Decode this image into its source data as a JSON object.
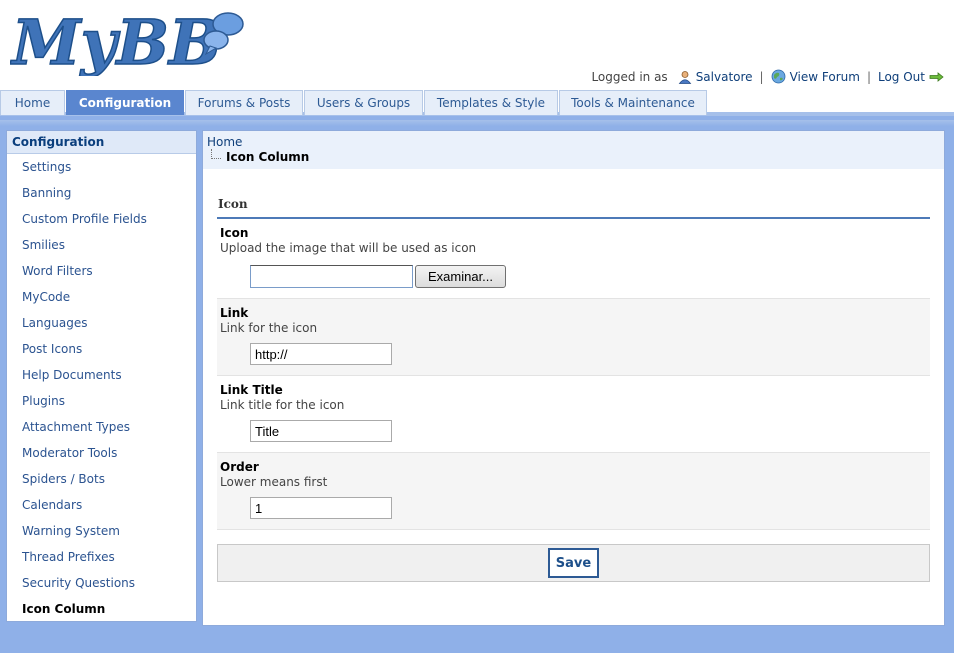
{
  "logo": {
    "text": "MyBB"
  },
  "userbar": {
    "logged_in_label": "Logged in as",
    "username": "Salvatore",
    "view_forum": "View Forum",
    "logout": "Log Out"
  },
  "tabs": [
    {
      "label": "Home",
      "active": false
    },
    {
      "label": "Configuration",
      "active": true
    },
    {
      "label": "Forums & Posts",
      "active": false
    },
    {
      "label": "Users & Groups",
      "active": false
    },
    {
      "label": "Templates & Style",
      "active": false
    },
    {
      "label": "Tools & Maintenance",
      "active": false
    }
  ],
  "sidebar": {
    "title": "Configuration",
    "items": [
      {
        "label": "Settings"
      },
      {
        "label": "Banning"
      },
      {
        "label": "Custom Profile Fields"
      },
      {
        "label": "Smilies"
      },
      {
        "label": "Word Filters"
      },
      {
        "label": "MyCode"
      },
      {
        "label": "Languages"
      },
      {
        "label": "Post Icons"
      },
      {
        "label": "Help Documents"
      },
      {
        "label": "Plugins"
      },
      {
        "label": "Attachment Types"
      },
      {
        "label": "Moderator Tools"
      },
      {
        "label": "Spiders / Bots"
      },
      {
        "label": "Calendars"
      },
      {
        "label": "Warning System"
      },
      {
        "label": "Thread Prefixes"
      },
      {
        "label": "Security Questions"
      },
      {
        "label": "Icon Column",
        "active": true
      }
    ]
  },
  "breadcrumb": {
    "home": "Home",
    "current": "Icon Column"
  },
  "form": {
    "section_title": "Icon",
    "icon": {
      "label": "Icon",
      "desc": "Upload the image that will be used as icon",
      "button": "Examinar..."
    },
    "link": {
      "label": "Link",
      "desc": "Link for the icon",
      "value": "http://"
    },
    "link_title": {
      "label": "Link Title",
      "desc": "Link title for the icon",
      "value": "Title"
    },
    "order": {
      "label": "Order",
      "desc": "Lower means first",
      "value": "1"
    },
    "save": "Save"
  }
}
